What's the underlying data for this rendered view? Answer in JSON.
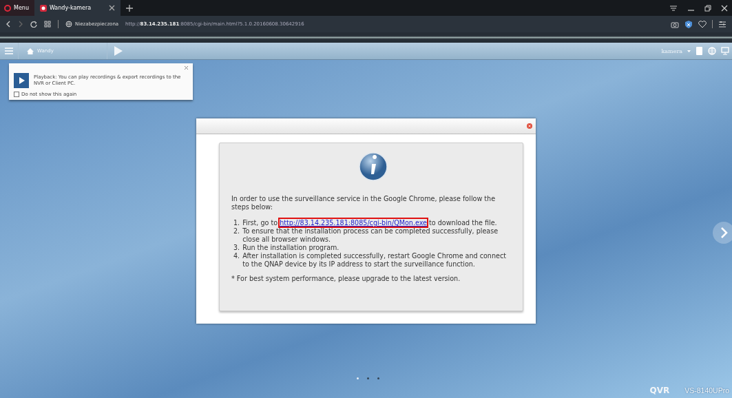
{
  "browser": {
    "menu_label": "Menu",
    "tabs": [
      {
        "label": "Wandy-kamera",
        "selected": true
      }
    ],
    "address": {
      "security": "Niezabezpieczona",
      "url": "http://**83.14.235.181**:8085/cgi-bin/main.html?5.1.0.20160608.30642916"
    }
  },
  "toolbar": {
    "breadcrumb": "Wandy",
    "user": "kamera"
  },
  "tip": {
    "text": "Playback: You can play recordings & export recordings to the NVR or Client PC.",
    "checkbox": {
      "label": "Do not show this again",
      "checked": false
    }
  },
  "dialog": {
    "intro": "In order to use the surveillance service in the Google Chrome, please follow the steps below:",
    "steps": [
      {
        "number": "1.",
        "before": "First, go to",
        "link": "http://83.14.235.181:8085/cgi-bin/QMon.exe",
        "highlighted": true,
        "after": "to download the file."
      },
      {
        "number": "2.",
        "before": "To ensure that the installation process can be completed successfully, please close all browser windows."
      },
      {
        "number": "3.",
        "before": "Run the installation program."
      },
      {
        "number": "4.",
        "before": "After installation is completed successfully, restart Google Chrome and connect to the QNAP device by its IP address to start the surveillance function."
      }
    ],
    "note": "* For best system performance, please upgrade to the latest version."
  },
  "pager": [
    {
      "selected": true
    },
    {
      "selected": false
    },
    {
      "selected": false
    }
  ],
  "brand": {
    "logo": "QVR",
    "model": "VS-8140UPro"
  }
}
